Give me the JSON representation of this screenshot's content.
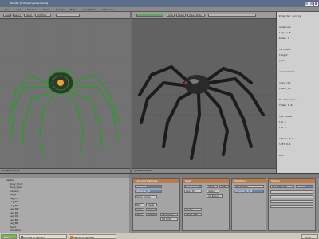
{
  "window": {
    "title": "Blender [C:\\Spider\\spider.blend]"
  },
  "menubar": {
    "items": [
      "File",
      "Add",
      "Timeline",
      "Game",
      "Render",
      "Help",
      "SR:2-Model",
      "SCE:Scene"
    ]
  },
  "left_view": {
    "header_buttons": [
      "View",
      "Select",
      "Object",
      "Edit Mode"
    ],
    "footer_label": "(1) spider_CB_BR"
  },
  "right_view": {
    "header_buttons": [
      "View",
      "Select",
      "Object Mode"
    ],
    "footer_label": "(1) spider_CB_BR"
  },
  "text_editor": {
    "lines": [
      "# Spider config",
      "",
      "armature",
      "   legs = 8",
      "   bones 4",
      "",
      "ik_chain",
      "   target",
      "   pole",
      "",
      "constraints",
      "",
      "copy_rot",
      "track_to",
      "",
      "# walk cycle",
      "frame 1-24",
      "",
      "ipo curve",
      "   loc z",
      "   rot x",
      "",
      "stride 0.5",
      "lift 0.2",
      "",
      "end"
    ]
  },
  "outliner": {
    "rows": [
      "spider",
      "Body_Front",
      "Body_Rear",
      "Camera",
      "Lamp",
      "Leg_FL",
      "Leg_FR",
      "Leg_ML",
      "Leg_MR",
      "Leg_RL",
      "Leg_RR",
      "Leg_BL",
      "Leg_BR",
      "Head",
      "Armature"
    ]
  },
  "panels": {
    "p1": {
      "title": "Link and Materials",
      "buttons": [
        "ME:Spider",
        "OB:spider_CB",
        "Vertex Groups",
        "New",
        "Delete",
        "Assign",
        "Remove",
        "Select",
        "Deselect",
        "Set Smooth",
        "Set Solid"
      ]
    },
    "p2": {
      "title": "Mesh",
      "buttons": [
        "Auto Smooth",
        "Degr: 30",
        "Sticky",
        "Make",
        "VertCol",
        "UV Texture",
        "Center",
        "Center New"
      ]
    },
    "p3": {
      "title": "Modifiers",
      "buttons": [
        "Add Modifier",
        "To: spider_CB_BR"
      ]
    },
    "p4": {
      "title": "Shapes",
      "buttons": [
        "Add Shape Key",
        "Relative"
      ]
    }
  },
  "taskbar": {
    "items": [
      "start",
      "animals [C:\\Spider]",
      "Blender [C:\\Spider]"
    ],
    "clock": "10:48"
  },
  "colors": {
    "wire": "#1fa31f",
    "highlight": "#f0a030"
  }
}
